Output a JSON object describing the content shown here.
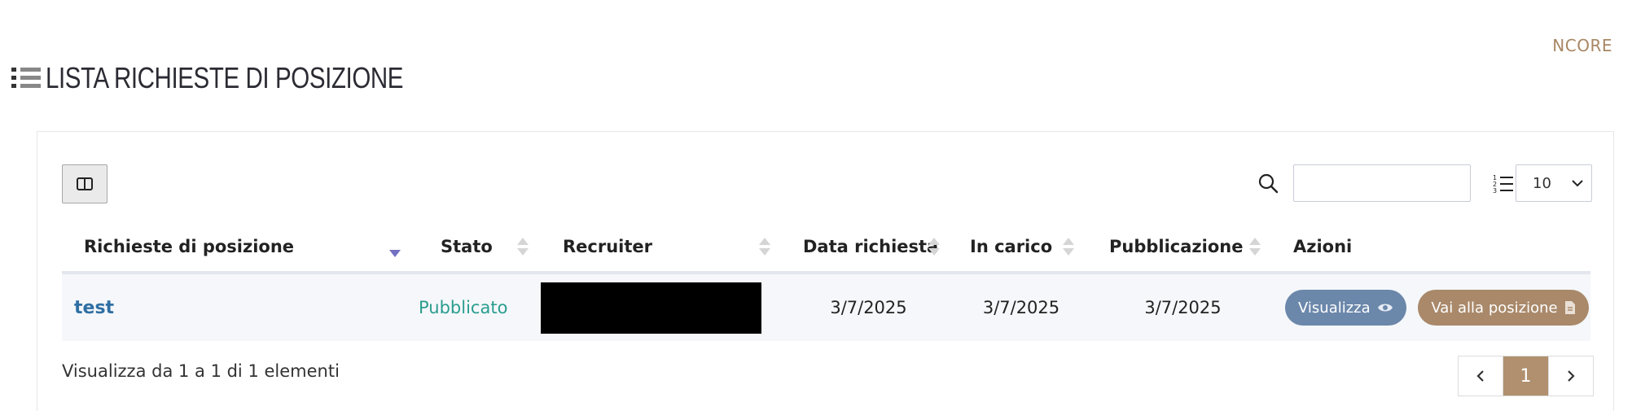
{
  "top_link": "NCORE",
  "page_title": "LISTA RICHIESTE DI POSIZIONE",
  "toolbar": {
    "search_value": "",
    "page_length": "10"
  },
  "table": {
    "headers": {
      "name": "Richieste di posizione",
      "status": "Stato",
      "recruiter": "Recruiter",
      "date": "Data richiesta",
      "assigned": "In carico",
      "published": "Pubblicazione",
      "actions": "Azioni"
    },
    "rows": [
      {
        "name": "test",
        "status": "Pubblicato",
        "recruiter": "",
        "date": "3/7/2025",
        "assigned": "3/7/2025",
        "published": "3/7/2025",
        "view_label": "Visualizza",
        "goto_label": "Vai alla posizione"
      }
    ]
  },
  "footer": {
    "info": "Visualizza da 1 a 1 di 1 elementi",
    "current_page": "1"
  },
  "colors": {
    "accent": "#a88763",
    "status": "#2a9d8f",
    "view_button": "#6b87aa",
    "goto_button": "#a9896a"
  }
}
